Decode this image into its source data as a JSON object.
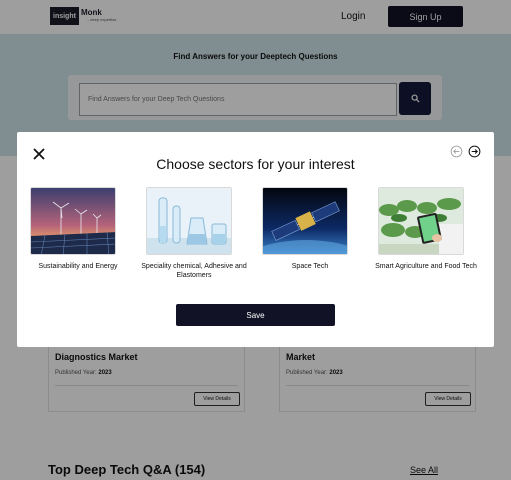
{
  "nav": {
    "logo_main": "insight",
    "logo_word": "Monk",
    "logo_tagline": "...deep expertise",
    "login": "Login",
    "signup": "Sign Up"
  },
  "hero": {
    "title": "Find Answers for your Deeptech Questions",
    "search_placeholder": "Find Answers for your Deep Tech Questions"
  },
  "cards": [
    {
      "title": "Diagnostics Market",
      "year_label": "Published Year:",
      "year": "2023",
      "button": "View Details"
    },
    {
      "title": "Market",
      "year_label": "Published Year:",
      "year": "2023",
      "button": "View Details"
    }
  ],
  "qa": {
    "title": "Top Deep Tech Q&A (154)",
    "see_all": "See All"
  },
  "modal": {
    "title": "Choose sectors for your interest",
    "sectors": [
      {
        "label": "Sustainability and Energy",
        "icon": "wind-turbine-solar-image"
      },
      {
        "label": "Speciality chemical, Adhesive and Elastomers",
        "icon": "lab-glassware-image"
      },
      {
        "label": "Space Tech",
        "icon": "satellite-image"
      },
      {
        "label": "Smart Agriculture and Food Tech",
        "icon": "greenhouse-tablet-image"
      }
    ],
    "save": "Save"
  },
  "colors": {
    "primary_dark": "#111226",
    "hero_bg": "#cfe6ea",
    "overlay": "rgba(0,0,0,0.38)"
  }
}
